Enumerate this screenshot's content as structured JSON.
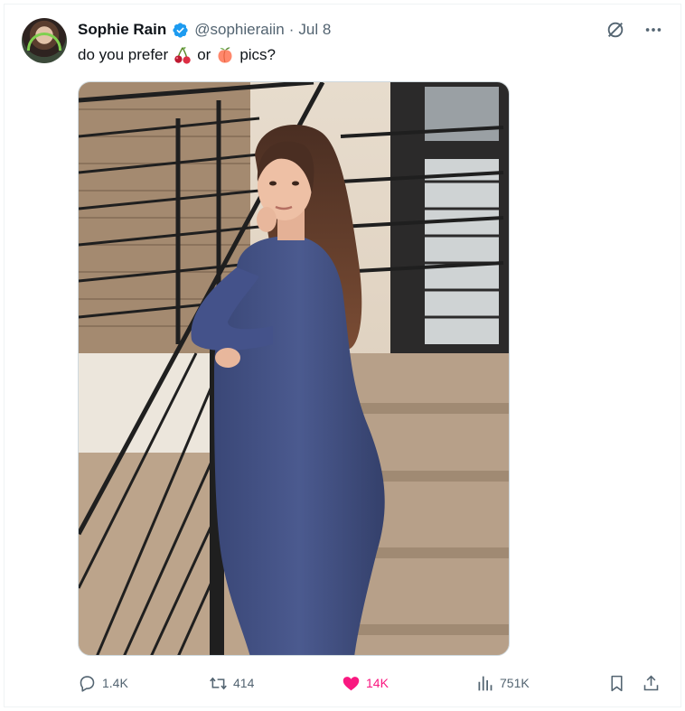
{
  "tweet": {
    "author_name": "Sophie Rain",
    "handle": "@sophieraiin",
    "separator": "·",
    "date": "Jul 8",
    "text_before": "do you prefer",
    "text_middle": "or",
    "text_after": "pics?",
    "emoji_1": "cherries-emoji",
    "emoji_2": "peach-emoji",
    "verified_color": "#1d9bf0"
  },
  "actions": {
    "replies": "1.4K",
    "reposts": "414",
    "likes": "14K",
    "views": "751K",
    "liked": true,
    "like_color": "#f91880"
  },
  "icons": [
    "grok-icon",
    "more-icon",
    "reply-icon",
    "repost-icon",
    "heart-icon",
    "views-icon",
    "bookmark-icon",
    "share-icon"
  ]
}
